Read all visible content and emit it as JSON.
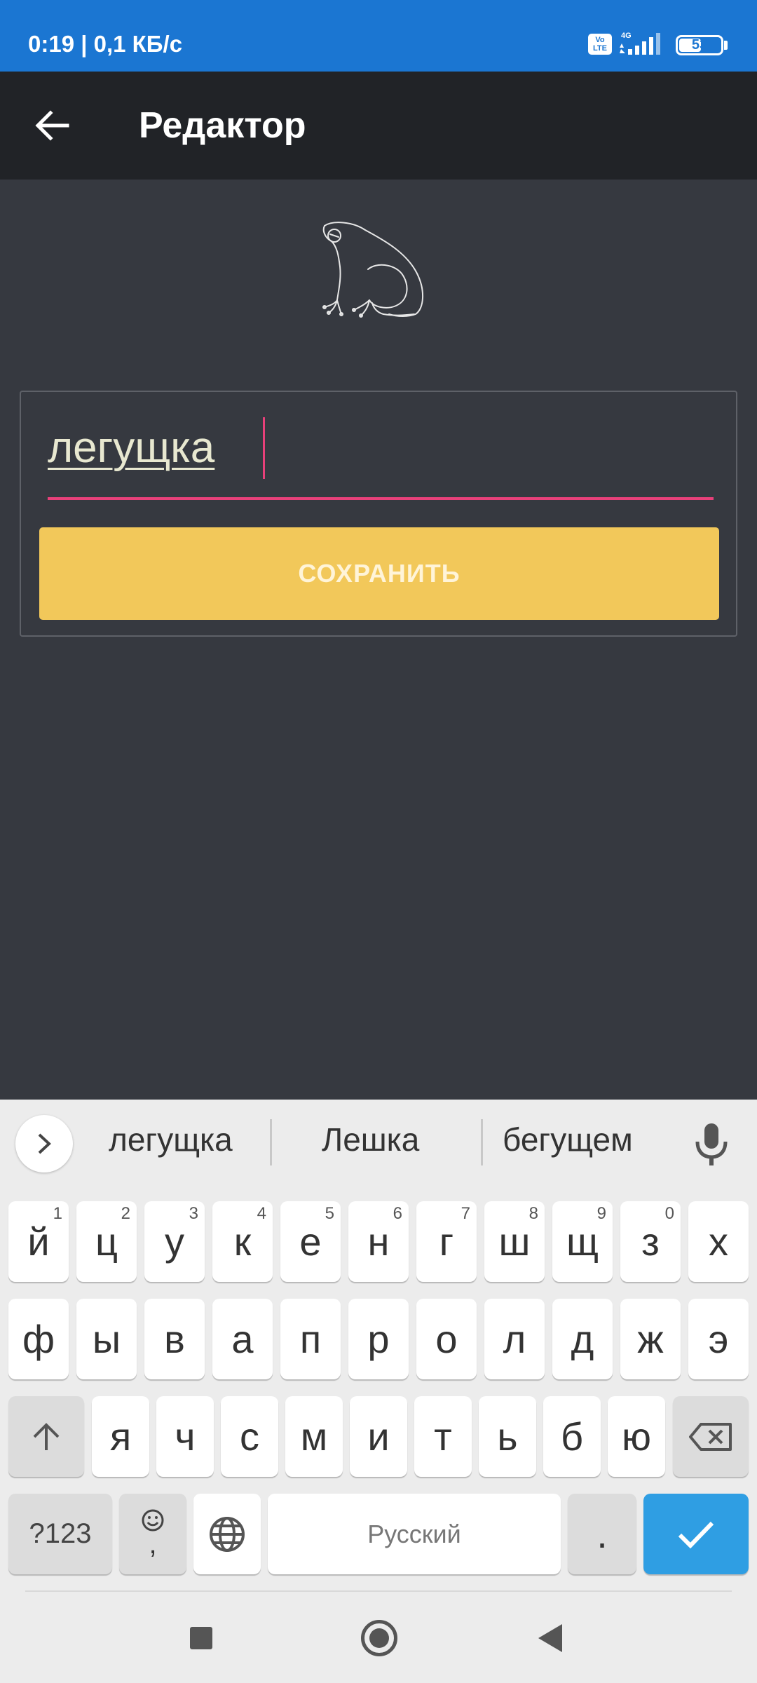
{
  "status_bar": {
    "time_speed": "0:19 | 0,1 КБ/с",
    "volte_top": "Vo",
    "volte_bottom": "LTE",
    "network": "4G",
    "battery": "53",
    "battery_level": 0.53
  },
  "app_bar": {
    "title": "Редактор",
    "back_icon": "arrow-left-icon"
  },
  "editor": {
    "input_value": "легущка",
    "save_label": "СОХРАНИТЬ",
    "icon": "frog-icon"
  },
  "keyboard": {
    "suggestions": [
      "легущка",
      "Лешка",
      "бегущем"
    ],
    "row1": [
      {
        "k": "й",
        "h": "1"
      },
      {
        "k": "ц",
        "h": "2"
      },
      {
        "k": "у",
        "h": "3"
      },
      {
        "k": "к",
        "h": "4"
      },
      {
        "k": "е",
        "h": "5"
      },
      {
        "k": "н",
        "h": "6"
      },
      {
        "k": "г",
        "h": "7"
      },
      {
        "k": "ш",
        "h": "8"
      },
      {
        "k": "щ",
        "h": "9"
      },
      {
        "k": "з",
        "h": "0"
      },
      {
        "k": "х",
        "h": ""
      }
    ],
    "row2": [
      "ф",
      "ы",
      "в",
      "а",
      "п",
      "р",
      "о",
      "л",
      "д",
      "ж",
      "э"
    ],
    "row3": [
      "я",
      "ч",
      "с",
      "м",
      "и",
      "т",
      "ь",
      "б",
      "ю"
    ],
    "symbols_label": "?123",
    "emoji_comma": ",",
    "space_label": "Русский",
    "period": ".",
    "enter_color": "#2f9ee3"
  },
  "colors": {
    "accent": "#e8407a",
    "button": "#f2c85a",
    "status_bar": "#1b76d2"
  }
}
